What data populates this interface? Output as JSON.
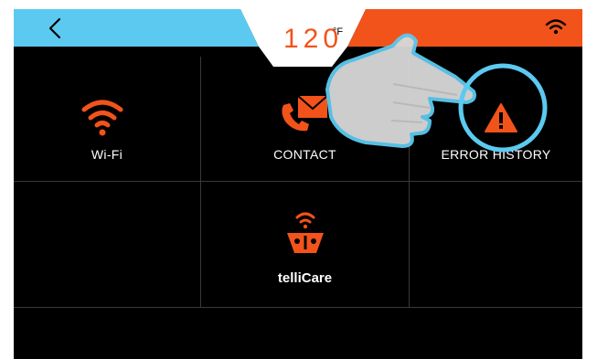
{
  "header": {
    "temperature": "120",
    "temperature_unit": "°F",
    "back_label": "Back",
    "colors": {
      "left_band": "#5ccaf0",
      "right_band": "#f2531b",
      "accent": "#f2531b"
    }
  },
  "tiles": [
    {
      "id": "wifi",
      "label": "Wi-Fi",
      "icon": "wifi-icon"
    },
    {
      "id": "contact",
      "label": "CONTACT",
      "icon": "phone-envelope-icon"
    },
    {
      "id": "error-history",
      "label": "ERROR HISTORY",
      "icon": "warning-triangle-icon"
    },
    {
      "id": "tellicare",
      "label_prefix": "telli",
      "label_suffix": "Care",
      "icon": "tellicare-logo-icon"
    }
  ],
  "overlay": {
    "icon": "pointing-hand-icon",
    "highlight": "highlight-circle"
  }
}
